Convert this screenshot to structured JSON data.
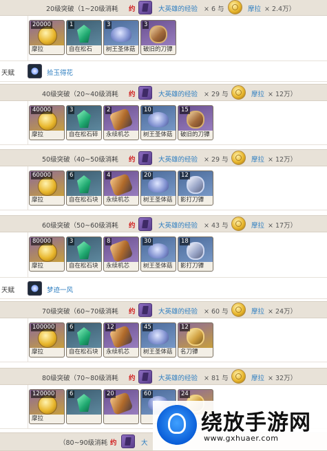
{
  "sections": [
    {
      "title": "20级突破（1~20级消耗",
      "yue": "约",
      "exp_name": "大英雄的经验",
      "exp_mult": "× 6 与",
      "mora_name": "摩拉",
      "mora_mult": "× 2.4万）",
      "items": [
        {
          "count": "20000",
          "name": "摩拉",
          "icon": "mora-coin-icon",
          "art": "gold",
          "shape": "s-coin"
        },
        {
          "count": "1",
          "name": "自在松石",
          "icon": "turquoise-gem-icon",
          "art": "green",
          "shape": "s-gem"
        },
        {
          "count": "3",
          "name": "树王圣体菇",
          "icon": "mushroom-icon",
          "art": "blue",
          "shape": "s-mush"
        },
        {
          "count": "3",
          "name": "破旧的刀镡",
          "icon": "tsuba-icon",
          "art": "purple",
          "shape": "s-guard"
        }
      ]
    },
    {
      "title": "40级突破（20~40级消耗",
      "yue": "约",
      "exp_name": "大英雄的经验",
      "exp_mult": "× 29 与",
      "mora_name": "摩拉",
      "mora_mult": "× 12万）",
      "items": [
        {
          "count": "40000",
          "name": "摩拉",
          "icon": "mora-coin-icon",
          "art": "gold",
          "shape": "s-coin"
        },
        {
          "count": "3",
          "name": "自在松石碎",
          "icon": "turquoise-gem-icon",
          "art": "green",
          "shape": "s-gem"
        },
        {
          "count": "2",
          "name": "永续机芯",
          "icon": "perpetual-core-icon",
          "art": "purple",
          "shape": "s-core"
        },
        {
          "count": "10",
          "name": "树王圣体菇",
          "icon": "mushroom-icon",
          "art": "blue",
          "shape": "s-mush"
        },
        {
          "count": "15",
          "name": "破旧的刀镡",
          "icon": "tsuba-icon",
          "art": "purple",
          "shape": "s-guard"
        }
      ]
    },
    {
      "title": "50级突破（40~50级消耗",
      "yue": "约",
      "exp_name": "大英雄的经验",
      "exp_mult": "× 29 与",
      "mora_name": "摩拉",
      "mora_mult": "× 12万）",
      "items": [
        {
          "count": "60000",
          "name": "摩拉",
          "icon": "mora-coin-icon",
          "art": "gold",
          "shape": "s-coin"
        },
        {
          "count": "6",
          "name": "自在松石块",
          "icon": "turquoise-gem-icon",
          "art": "green",
          "shape": "s-gem"
        },
        {
          "count": "4",
          "name": "永续机芯",
          "icon": "perpetual-core-icon",
          "art": "purple",
          "shape": "s-core"
        },
        {
          "count": "20",
          "name": "树王圣体菇",
          "icon": "mushroom-icon",
          "art": "blue",
          "shape": "s-mush"
        },
        {
          "count": "12",
          "name": "影打刀镡",
          "icon": "tsuba-icon",
          "art": "blue",
          "shape": "s-guard2"
        }
      ]
    },
    {
      "title": "60级突破（50~60级消耗",
      "yue": "约",
      "exp_name": "大英雄的经验",
      "exp_mult": "× 43 与",
      "mora_name": "摩拉",
      "mora_mult": "× 17万）",
      "items": [
        {
          "count": "80000",
          "name": "摩拉",
          "icon": "mora-coin-icon",
          "art": "gold",
          "shape": "s-coin"
        },
        {
          "count": "3",
          "name": "自在松石块",
          "icon": "turquoise-gem-icon",
          "art": "green",
          "shape": "s-gem"
        },
        {
          "count": "8",
          "name": "永续机芯",
          "icon": "perpetual-core-icon",
          "art": "purple",
          "shape": "s-core"
        },
        {
          "count": "30",
          "name": "树王圣体菇",
          "icon": "mushroom-icon",
          "art": "blue",
          "shape": "s-mush"
        },
        {
          "count": "18",
          "name": "影打刀镡",
          "icon": "tsuba-icon",
          "art": "blue",
          "shape": "s-guard2"
        }
      ]
    },
    {
      "title": "70级突破（60~70级消耗",
      "yue": "约",
      "exp_name": "大英雄的经验",
      "exp_mult": "× 60 与",
      "mora_name": "摩拉",
      "mora_mult": "× 24万）",
      "items": [
        {
          "count": "100000",
          "name": "摩拉",
          "icon": "mora-coin-icon",
          "art": "gold",
          "shape": "s-coin"
        },
        {
          "count": "6",
          "name": "自在松石块",
          "icon": "turquoise-gem-icon",
          "art": "green",
          "shape": "s-gem"
        },
        {
          "count": "12",
          "name": "永续机芯",
          "icon": "perpetual-core-icon",
          "art": "purple",
          "shape": "s-core"
        },
        {
          "count": "45",
          "name": "树王圣体菇",
          "icon": "mushroom-icon",
          "art": "blue",
          "shape": "s-mush"
        },
        {
          "count": "12",
          "name": "名刀镡",
          "icon": "tsuba-icon",
          "art": "gold",
          "shape": "s-guard3"
        }
      ]
    },
    {
      "title": "80级突破（70~80级消耗",
      "yue": "约",
      "exp_name": "大英雄的经验",
      "exp_mult": "× 81 与",
      "mora_name": "摩拉",
      "mora_mult": "× 32万）",
      "items": [
        {
          "count": "120000",
          "name": "摩拉",
          "icon": "mora-coin-icon",
          "art": "gold",
          "shape": "s-coin"
        },
        {
          "count": "6",
          "name": "",
          "icon": "turquoise-gem-icon",
          "art": "green",
          "shape": "s-gem"
        },
        {
          "count": "20",
          "name": "",
          "icon": "perpetual-core-icon",
          "art": "purple",
          "shape": "s-core"
        },
        {
          "count": "60",
          "name": "",
          "icon": "mushroom-icon",
          "art": "blue",
          "shape": "s-mush"
        },
        {
          "count": "24",
          "name": "",
          "icon": "tsuba-icon",
          "art": "gold",
          "shape": "s-guard3"
        }
      ]
    },
    {
      "title": "（80~90级消耗",
      "yue": "约",
      "exp_name": "大",
      "exp_mult": "",
      "mora_name": "",
      "mora_mult": "",
      "items": []
    }
  ],
  "talents": [
    {
      "label": "天赋",
      "name": "拾玉得花",
      "icon": "talent-icon"
    },
    {
      "label": "天赋",
      "name": "梦迹一风",
      "icon": "talent-icon"
    }
  ],
  "watermark": {
    "brand": "绕放手游网",
    "url": "www.gxhuaer.com"
  }
}
